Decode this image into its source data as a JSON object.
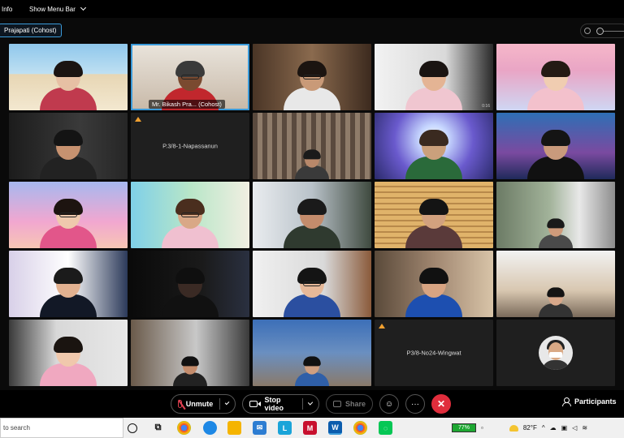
{
  "menubar": {
    "items": [
      "Info",
      "Show Menu Bar"
    ]
  },
  "speaker": {
    "label": "Prajapati (Cohost)"
  },
  "tiles": [
    {
      "type": "video",
      "scene": "beach-woman"
    },
    {
      "type": "video",
      "scene": "host",
      "caption": "Mr. Bikash Pra... (Cohost)",
      "active": true
    },
    {
      "type": "video",
      "scene": "shelves-girl"
    },
    {
      "type": "video",
      "scene": "heart-girl",
      "stamp": "0:16"
    },
    {
      "type": "video",
      "scene": "pink-sky-girl"
    },
    {
      "type": "video",
      "scene": "dark-boy"
    },
    {
      "type": "name",
      "name": "P.3/8-1-Napassanun",
      "warning": true
    },
    {
      "type": "video",
      "scene": "curtain"
    },
    {
      "type": "video",
      "scene": "anime-light"
    },
    {
      "type": "video",
      "scene": "anime-boy"
    },
    {
      "type": "video",
      "scene": "sunset-girl"
    },
    {
      "type": "video",
      "scene": "turtle-girl"
    },
    {
      "type": "video",
      "scene": "sofa-boy"
    },
    {
      "type": "video",
      "scene": "blinds-boy"
    },
    {
      "type": "video",
      "scene": "tree-room"
    },
    {
      "type": "video",
      "scene": "headset-girl"
    },
    {
      "type": "video",
      "scene": "dark-headset"
    },
    {
      "type": "video",
      "scene": "glasses-boy"
    },
    {
      "type": "video",
      "scene": "wave-boy"
    },
    {
      "type": "video",
      "scene": "room-girl"
    },
    {
      "type": "video",
      "scene": "pink-chair"
    },
    {
      "type": "video",
      "scene": "dark-room-boy"
    },
    {
      "type": "video",
      "scene": "blue-room"
    },
    {
      "type": "name",
      "name": "P3/8-No24-Wingwat",
      "warning": true
    },
    {
      "type": "avatar",
      "scene": "masked-woman"
    }
  ],
  "controls": {
    "unmute": "Unmute",
    "stop_video": "Stop video",
    "share": "Share",
    "reactions": "☺",
    "more": "···",
    "end": "✕",
    "participants": "Participants"
  },
  "taskbar": {
    "search_placeholder": "to search",
    "battery": "77%",
    "temperature": "82°F"
  },
  "colors": {
    "accent": "#3a9ad9",
    "end_call": "#e02d3c",
    "warning": "#f0a030"
  }
}
